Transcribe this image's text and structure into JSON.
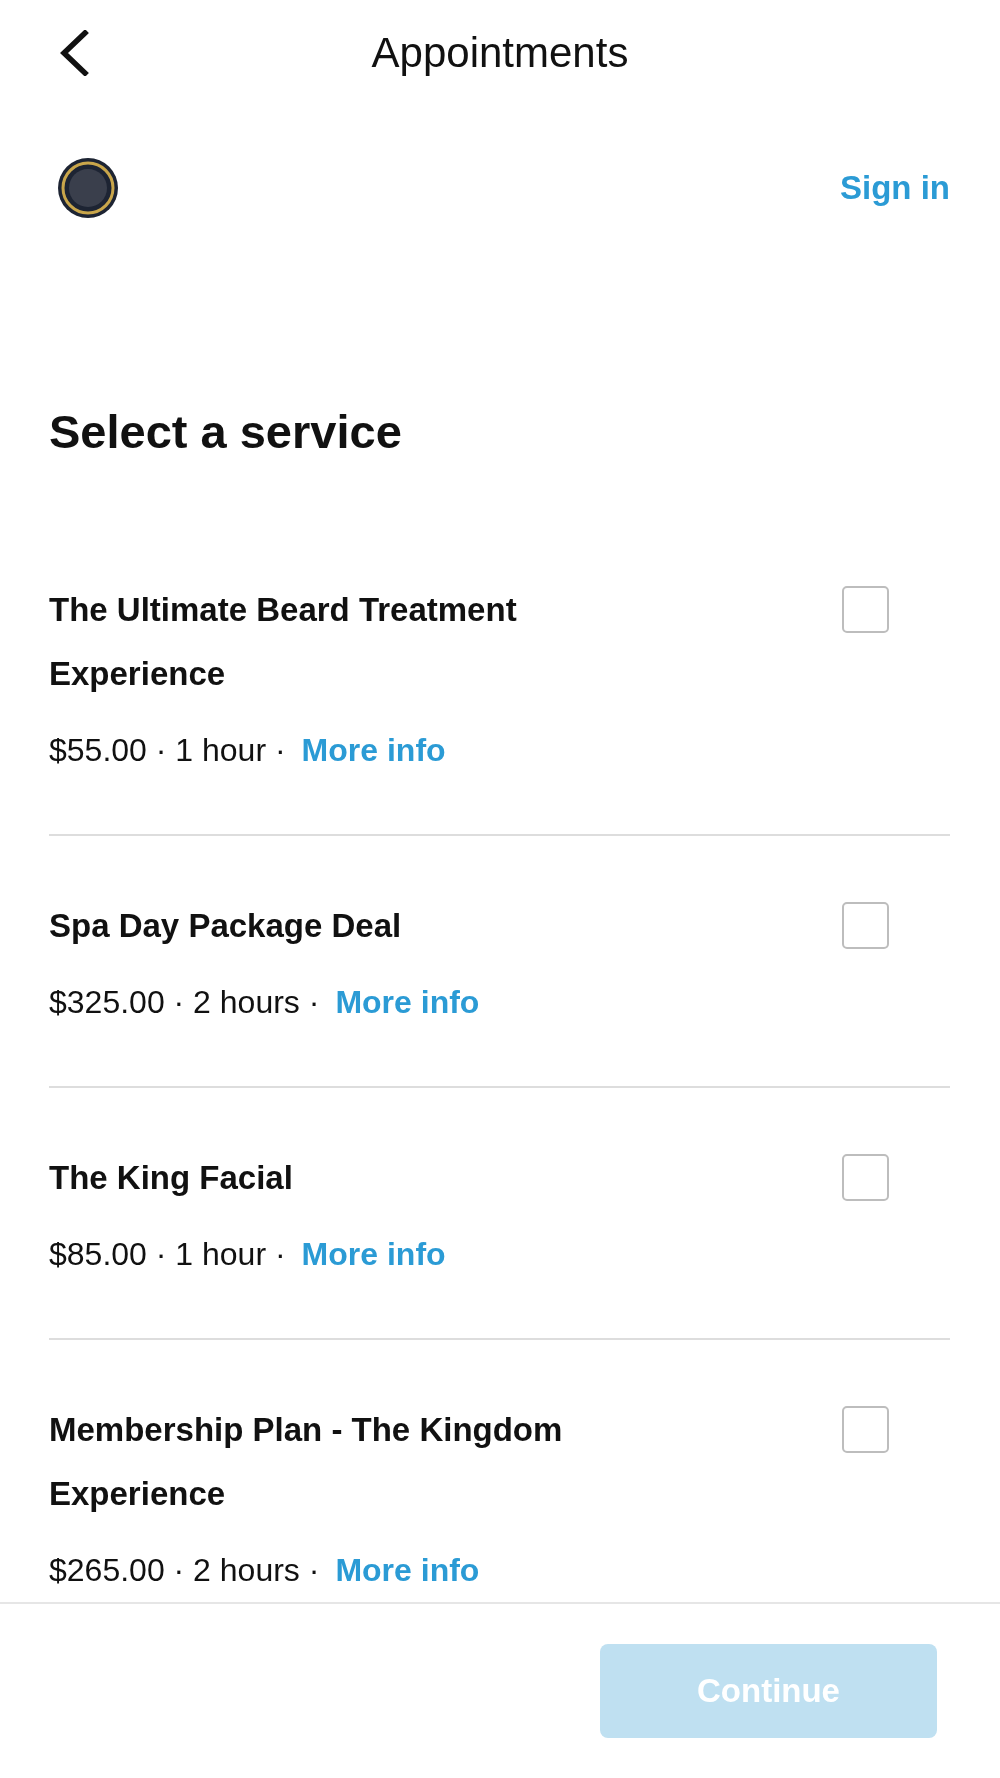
{
  "header": {
    "title": "Appointments"
  },
  "account": {
    "sign_in": "Sign in"
  },
  "section": {
    "heading": "Select a service"
  },
  "services": [
    {
      "name": "The Ultimate Beard Treatment Experience",
      "details": "$55.00 · 1 hour ·",
      "link": "More info",
      "selected": false
    },
    {
      "name": "Spa Day Package Deal",
      "details": "$325.00 · 2 hours ·",
      "link": "More info",
      "selected": false
    },
    {
      "name": "The King Facial",
      "details": "$85.00 · 1 hour ·",
      "link": "More info",
      "selected": false
    },
    {
      "name": "Membership Plan - The Kingdom Experience",
      "details": "$265.00 · 2 hours ·",
      "link": "More info",
      "selected": false
    }
  ],
  "footer": {
    "button": {
      "label": "Continue",
      "disabled": true
    }
  }
}
